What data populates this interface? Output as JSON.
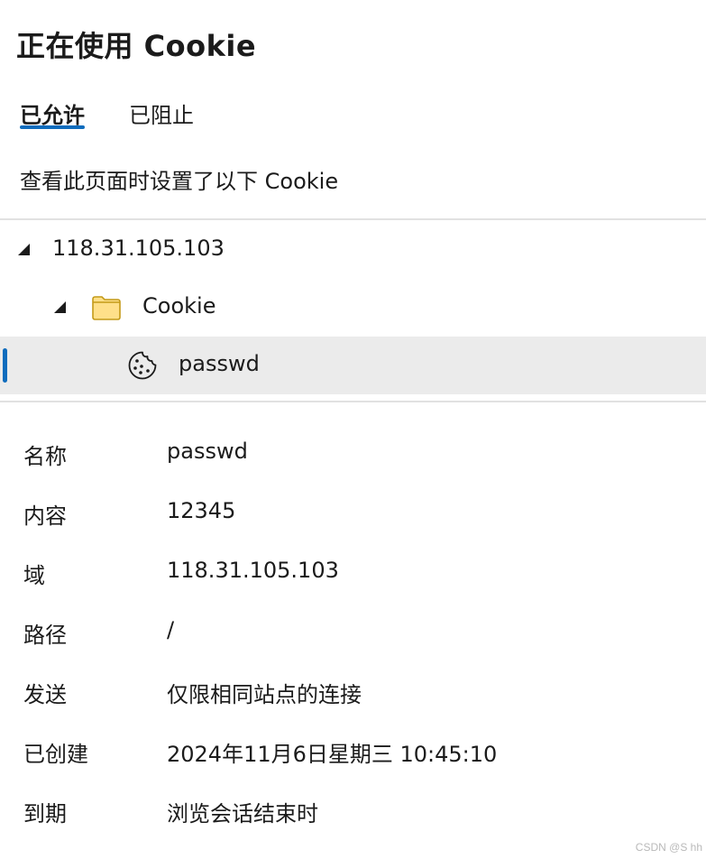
{
  "header": {
    "title": "正在使用 Cookie"
  },
  "tabs": [
    {
      "label": "已允许",
      "active": true
    },
    {
      "label": "已阻止",
      "active": false
    }
  ],
  "description": "查看此页面时设置了以下 Cookie",
  "tree": {
    "site": {
      "label": "118.31.105.103",
      "expanded": true,
      "icon": "expanded-chevron-icon"
    },
    "folder": {
      "label": "Cookie",
      "expanded": true,
      "icon": "folder-icon"
    },
    "cookie": {
      "label": "passwd",
      "selected": true,
      "icon": "cookie-icon"
    }
  },
  "details": [
    {
      "key": "名称",
      "value": "passwd"
    },
    {
      "key": "内容",
      "value": "12345"
    },
    {
      "key": "域",
      "value": "118.31.105.103"
    },
    {
      "key": "路径",
      "value": "/"
    },
    {
      "key": "发送",
      "value": "仅限相同站点的连接"
    },
    {
      "key": "已创建",
      "value": "2024年11月6日星期三 10:45:10"
    },
    {
      "key": "到期",
      "value": "浏览会话结束时"
    }
  ],
  "watermark": "CSDN @S   hh",
  "colors": {
    "accent": "#0f6cbd",
    "selected_row": "#ebebeb",
    "divider": "#e1e1e1",
    "folder_fill": "#ffe08a",
    "folder_stroke": "#c49a18"
  }
}
